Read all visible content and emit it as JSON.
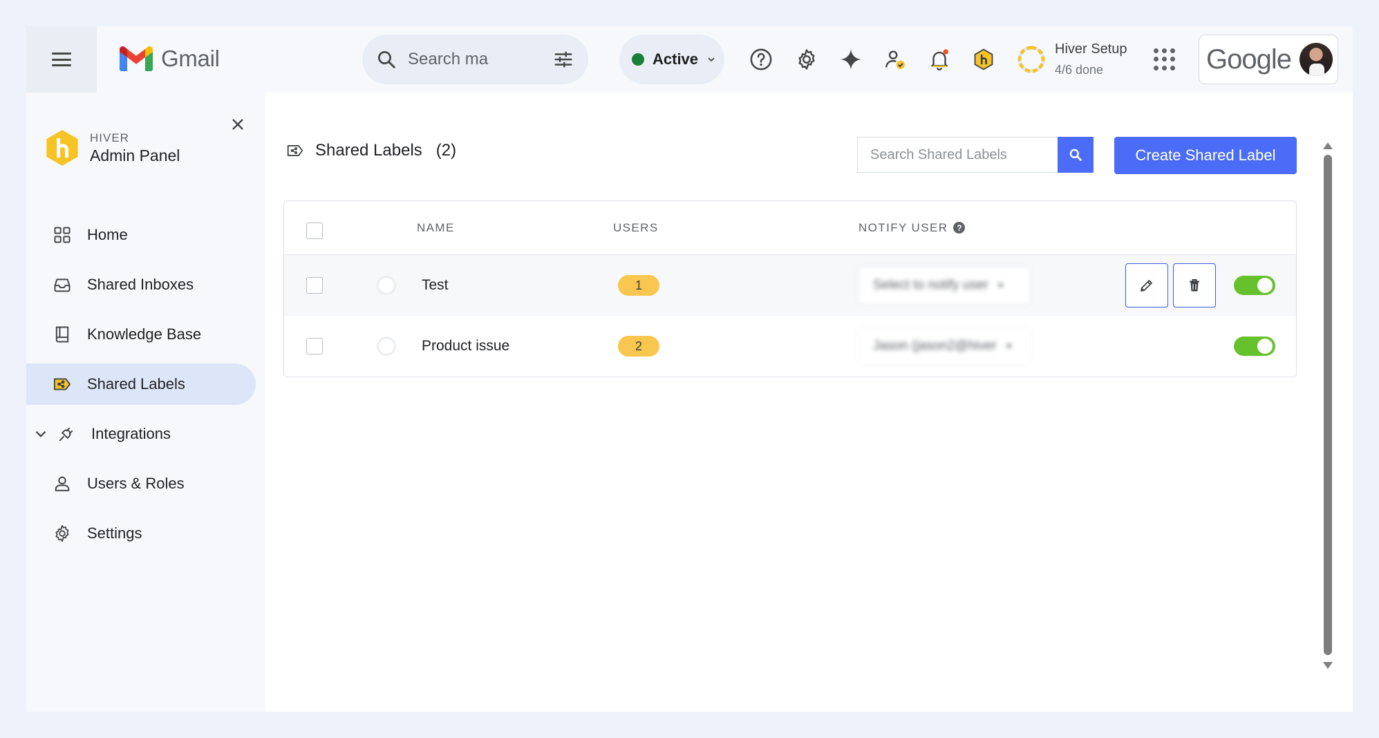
{
  "topbar": {
    "app_name": "Gmail",
    "search_placeholder": "Search ma",
    "status_label": "Active",
    "status_color": "#188038",
    "icons": [
      "help-icon",
      "settings-gear-icon",
      "gemini-sparkle-icon",
      "user-check-icon",
      "notification-bell-icon",
      "hiver-hex-icon"
    ],
    "setup": {
      "title": "Hiver Setup",
      "progress": "4/6 done",
      "done": 4,
      "total": 6
    },
    "account_brand": "Google"
  },
  "sidebar": {
    "kicker": "HIVER",
    "title": "Admin Panel",
    "items": [
      {
        "label": "Home",
        "icon": "grid-icon"
      },
      {
        "label": "Shared Inboxes",
        "icon": "inbox-icon"
      },
      {
        "label": "Knowledge Base",
        "icon": "book-icon"
      },
      {
        "label": "Shared Labels",
        "icon": "shared-label-icon",
        "active": true
      },
      {
        "label": "Integrations",
        "icon": "plug-icon",
        "expandable": true
      },
      {
        "label": "Users & Roles",
        "icon": "user-icon"
      },
      {
        "label": "Settings",
        "icon": "settings-gear-icon"
      }
    ]
  },
  "main": {
    "title": "Shared Labels",
    "count": "(2)",
    "search_placeholder": "Search Shared Labels",
    "create_button": "Create Shared Label",
    "columns": {
      "name": "NAME",
      "users": "USERS",
      "notify": "NOTIFY USER",
      "notify_help": "?"
    },
    "rows": [
      {
        "name": "Test",
        "users": "1",
        "notify": "Select to notify user",
        "enabled": true
      },
      {
        "name": "Product issue",
        "users": "2",
        "notify": "Jason (jason2@hiver",
        "enabled": true
      }
    ]
  },
  "colors": {
    "accent": "#4a6cf7",
    "badge": "#f9c74f",
    "toggle_on": "#66c22c",
    "hiver_yellow": "#f7c325"
  }
}
